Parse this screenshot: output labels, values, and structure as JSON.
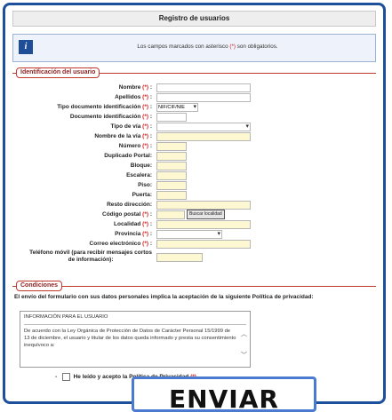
{
  "header": {
    "title": "Registro de usuarios"
  },
  "notice": {
    "text_before": "Los campos marcados con asterisco ",
    "asterisk": "(*)",
    "text_after": " son obligatorios."
  },
  "sections": {
    "user_id": "Identificación del usuario",
    "conditions": "Condiciones"
  },
  "required_mark": "(*)",
  "form": {
    "nombre": "Nombre",
    "apellidos": "Apellidos",
    "tipo_doc": "Tipo documento identificación",
    "tipo_doc_value": "NIF/CIF/NIE",
    "doc_id": "Documento identificación",
    "tipo_via": "Tipo de vía",
    "nombre_via": "Nombre de la vía",
    "numero": "Número",
    "duplicado": "Duplicado Portal:",
    "bloque": "Bloque:",
    "escalera": "Escalera:",
    "piso": "Piso:",
    "puerta": "Puerta:",
    "resto": "Resto dirección:",
    "cp": "Código postal",
    "buscar_localidad": "Buscar localidad",
    "localidad": "Localidad",
    "provincia": "Provincia",
    "correo": "Correo electrónico",
    "movil_line1": "Teléfono móvil (para recibir mensajes cortos",
    "movil_line2": "de información):"
  },
  "privacy": {
    "statement": "El envío del formulario con sus datos personales implica la aceptación de la siguiente Política de privacidad:",
    "box_title": "INFORMACIÓN PARA EL USUARIO",
    "box_body": "De acuerdo con la Ley Orgánica de Protección de Datos de Carácter Personal 15/1999 de 13 de diciembre, el usuario y titular de los datos queda informado y presta su consentimiento inequívoco a:",
    "accept_label": "He leído y acepto la Política de Privacidad",
    "dash": "-"
  },
  "submit_label": "ENVIAR",
  "colors": {
    "frame": "#1c4f9c",
    "required": "#d21d1d",
    "field": "#fdf7d2",
    "section": "#c0392b"
  }
}
